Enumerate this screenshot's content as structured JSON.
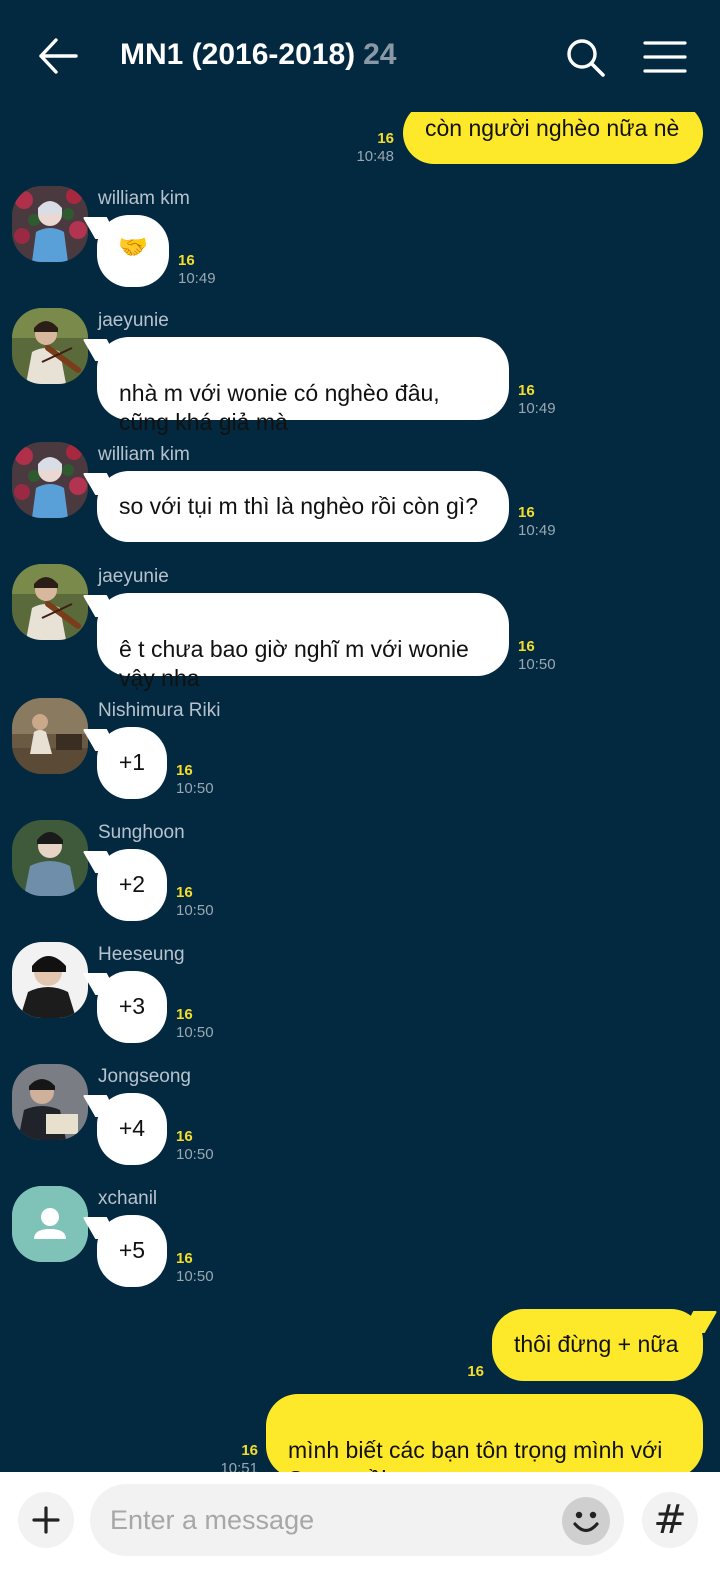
{
  "header": {
    "title": "MN1 (2016-2018)",
    "member_count": "24",
    "icons": [
      "back-arrow-icon",
      "search-icon",
      "menu-icon"
    ]
  },
  "colors": {
    "background": "#022940",
    "outgoing_bubble": "#fde92a",
    "incoming_bubble": "#ffffff",
    "unread_count": "#f5dd2a"
  },
  "messages": [
    {
      "direction": "out",
      "text": "còn người nghèo nữa nè",
      "unread": "16",
      "time": "10:48"
    },
    {
      "direction": "in",
      "sender": "william kim",
      "text": "🤝",
      "unread": "16",
      "time": "10:49"
    },
    {
      "direction": "in",
      "sender": "jaeyunie",
      "text": "nhà m với wonie có nghèo đâu,\ncũng khá giả mà",
      "unread": "16",
      "time": "10:49"
    },
    {
      "direction": "in",
      "sender": "william kim",
      "text": "so với tụi m thì là nghèo rồi còn gì?",
      "unread": "16",
      "time": "10:49"
    },
    {
      "direction": "in",
      "sender": "jaeyunie",
      "text": "ê t chưa bao giờ nghĩ m với wonie\nvậy nha",
      "unread": "16",
      "time": "10:50"
    },
    {
      "direction": "in",
      "sender": "Nishimura Riki",
      "text": "+1",
      "unread": "16",
      "time": "10:50"
    },
    {
      "direction": "in",
      "sender": "Sunghoon",
      "text": "+2",
      "unread": "16",
      "time": "10:50"
    },
    {
      "direction": "in",
      "sender": "Heeseung",
      "text": "+3",
      "unread": "16",
      "time": "10:50"
    },
    {
      "direction": "in",
      "sender": "Jongseong",
      "text": "+4",
      "unread": "16",
      "time": "10:50"
    },
    {
      "direction": "in",
      "sender": "xchanil",
      "text": "+5",
      "unread": "16",
      "time": "10:50"
    },
    {
      "direction": "out",
      "text": "thôi đừng + nữa",
      "unread": "16",
      "time": ""
    },
    {
      "direction": "out",
      "text": "mình biết các bạn tôn trọng mình với\nSunoo rồi",
      "unread": "16",
      "time": "10:51"
    }
  ],
  "input": {
    "placeholder": "Enter a message",
    "icons": [
      "plus-icon",
      "emoji-icon",
      "hashtag-icon"
    ],
    "hash_symbol": "#"
  }
}
